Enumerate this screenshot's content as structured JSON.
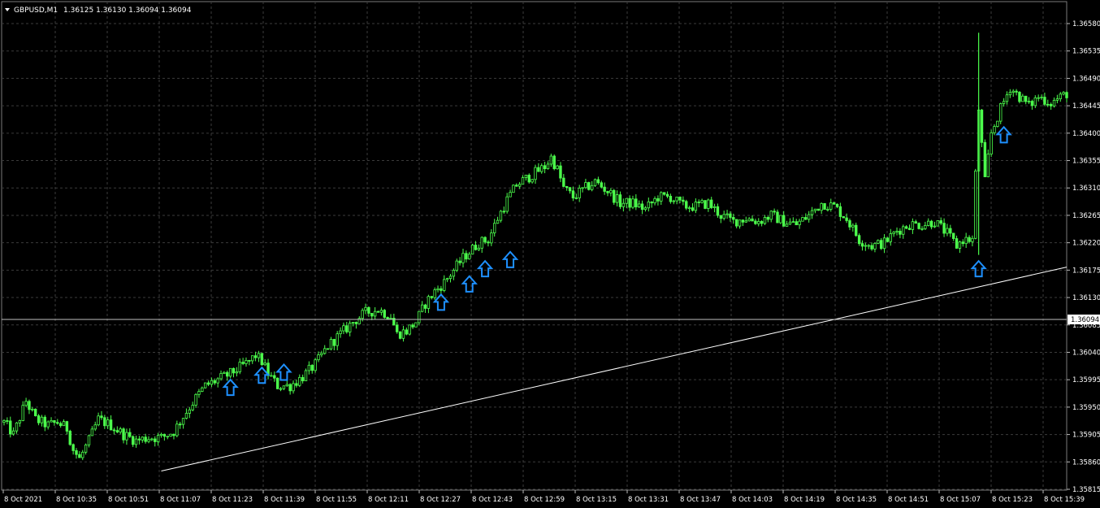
{
  "header": {
    "symbol": "GBPUSD,M1",
    "ohlc_text": "1.36125 1.36130 1.36094 1.36094"
  },
  "colors": {
    "background": "#000000",
    "grid": "#3b3b3b",
    "candle": "#4cff4c",
    "axis_text": "#ffffff",
    "arrow": "#1e90ff",
    "trendline": "#ffffff",
    "current_price_line": "#c0c0c0",
    "price_label_bg": "#ffffff",
    "price_label_text": "#000000"
  },
  "chart_data": {
    "type": "candlestick",
    "title": "GBPUSD,M1",
    "symbol": "GBPUSD",
    "timeframe": "M1",
    "ohlc": {
      "open": 1.36125,
      "high": 1.3613,
      "low": 1.36094,
      "close": 1.36094
    },
    "current_price": 1.36094,
    "current_price_label": "1.36094",
    "ylim": [
      1.35815,
      1.3658
    ],
    "y_ticks": [
      "1.36580",
      "1.36535",
      "1.36490",
      "1.36445",
      "1.36400",
      "1.36355",
      "1.36310",
      "1.36265",
      "1.36220",
      "1.36175",
      "1.36130",
      "1.36085",
      "1.36040",
      "1.35995",
      "1.35950",
      "1.35905",
      "1.35860",
      "1.35815"
    ],
    "x_ticks": [
      "8 Oct 2021",
      "8 Oct 10:35",
      "8 Oct 10:51",
      "8 Oct 11:07",
      "8 Oct 11:23",
      "8 Oct 11:39",
      "8 Oct 11:55",
      "8 Oct 12:11",
      "8 Oct 12:27",
      "8 Oct 12:43",
      "8 Oct 12:59",
      "8 Oct 13:15",
      "8 Oct 13:31",
      "8 Oct 13:47",
      "8 Oct 14:03",
      "8 Oct 14:19",
      "8 Oct 14:35",
      "8 Oct 14:51",
      "8 Oct 15:07",
      "8 Oct 15:23",
      "8 Oct 15:39"
    ],
    "x_range_minutes": [
      0,
      338
    ],
    "grid": true,
    "price_path": [
      [
        0,
        1.35925
      ],
      [
        3,
        1.35905
      ],
      [
        7,
        1.3596
      ],
      [
        10,
        1.3593
      ],
      [
        14,
        1.3592
      ],
      [
        17,
        1.35925
      ],
      [
        20,
        1.35915
      ],
      [
        22,
        1.3588
      ],
      [
        24,
        1.35865
      ],
      [
        27,
        1.35895
      ],
      [
        30,
        1.3593
      ],
      [
        34,
        1.3592
      ],
      [
        38,
        1.35905
      ],
      [
        42,
        1.35895
      ],
      [
        46,
        1.359
      ],
      [
        50,
        1.359
      ],
      [
        54,
        1.3591
      ],
      [
        57,
        1.35935
      ],
      [
        61,
        1.35965
      ],
      [
        64,
        1.35985
      ],
      [
        68,
        1.35995
      ],
      [
        72,
        1.36005
      ],
      [
        75,
        1.36015
      ],
      [
        78,
        1.36025
      ],
      [
        80,
        1.36035
      ],
      [
        82,
        1.36025
      ],
      [
        84,
        1.36005
      ],
      [
        87,
        1.35985
      ],
      [
        91,
        1.35985
      ],
      [
        95,
        1.36
      ],
      [
        99,
        1.3602
      ],
      [
        103,
        1.3605
      ],
      [
        107,
        1.3607
      ],
      [
        111,
        1.3609
      ],
      [
        115,
        1.36105
      ],
      [
        119,
        1.3611
      ],
      [
        123,
        1.361
      ],
      [
        125,
        1.3607
      ],
      [
        128,
        1.36075
      ],
      [
        131,
        1.3609
      ],
      [
        134,
        1.3612
      ],
      [
        137,
        1.3614
      ],
      [
        140,
        1.36155
      ],
      [
        143,
        1.36175
      ],
      [
        146,
        1.36195
      ],
      [
        148,
        1.36205
      ],
      [
        151,
        1.3622
      ],
      [
        154,
        1.36225
      ],
      [
        157,
        1.3626
      ],
      [
        160,
        1.3629
      ],
      [
        163,
        1.36315
      ],
      [
        166,
        1.36325
      ],
      [
        169,
        1.36335
      ],
      [
        172,
        1.36345
      ],
      [
        174,
        1.3636
      ],
      [
        176,
        1.3634
      ],
      [
        178,
        1.3631
      ],
      [
        181,
        1.36295
      ],
      [
        185,
        1.3631
      ],
      [
        188,
        1.3632
      ],
      [
        192,
        1.36305
      ],
      [
        196,
        1.36285
      ],
      [
        200,
        1.36285
      ],
      [
        204,
        1.36275
      ],
      [
        208,
        1.36295
      ],
      [
        212,
        1.36295
      ],
      [
        216,
        1.3628
      ],
      [
        220,
        1.3628
      ],
      [
        224,
        1.36285
      ],
      [
        228,
        1.36265
      ],
      [
        232,
        1.36255
      ],
      [
        236,
        1.3626
      ],
      [
        240,
        1.36255
      ],
      [
        244,
        1.36265
      ],
      [
        248,
        1.36255
      ],
      [
        252,
        1.3625
      ],
      [
        256,
        1.36265
      ],
      [
        260,
        1.36285
      ],
      [
        264,
        1.3628
      ],
      [
        268,
        1.3626
      ],
      [
        272,
        1.36225
      ],
      [
        276,
        1.36215
      ],
      [
        280,
        1.3622
      ],
      [
        284,
        1.3624
      ],
      [
        288,
        1.3625
      ],
      [
        292,
        1.3625
      ],
      [
        296,
        1.36255
      ],
      [
        300,
        1.36235
      ],
      [
        303,
        1.36215
      ],
      [
        305,
        1.36225
      ],
      [
        308,
        1.36225
      ],
      [
        310,
        1.3644
      ],
      [
        312,
        1.3632
      ],
      [
        314,
        1.364
      ],
      [
        317,
        1.3644
      ],
      [
        320,
        1.36475
      ],
      [
        323,
        1.3646
      ],
      [
        326,
        1.36445
      ],
      [
        329,
        1.3646
      ],
      [
        333,
        1.3645
      ],
      [
        338,
        1.36465
      ]
    ],
    "buy_arrows": [
      {
        "t": 72,
        "price": 1.35995
      },
      {
        "t": 82,
        "price": 1.36015
      },
      {
        "t": 89,
        "price": 1.3602
      },
      {
        "t": 139,
        "price": 1.36135
      },
      {
        "t": 148,
        "price": 1.36165
      },
      {
        "t": 153,
        "price": 1.3619
      },
      {
        "t": 161,
        "price": 1.36205
      },
      {
        "t": 310,
        "price": 1.3619
      },
      {
        "t": 318,
        "price": 1.3641
      }
    ],
    "trendline": {
      "t1": 50,
      "p1": 1.35845,
      "t2": 338,
      "p2": 1.3618
    }
  }
}
